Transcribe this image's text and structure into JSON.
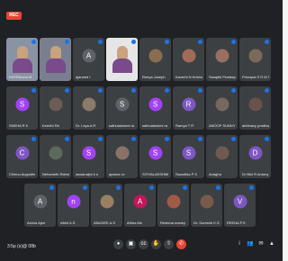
{
  "meeting": {
    "recording_badge": "REC",
    "time_label": "3:5p (s)@ 08b"
  },
  "participants": [
    {
      "name": "KEERthana M",
      "kind": "video",
      "color": "#8a93a3"
    },
    {
      "name": "",
      "kind": "video",
      "color": "#7a7f8f"
    },
    {
      "name": "ajaneed I",
      "kind": "avatar",
      "initial": "A",
      "color": "#5f6368"
    },
    {
      "name": "San....",
      "kind": "video",
      "color": "#e6e6e6"
    },
    {
      "name": "Reeya Joseph",
      "kind": "photo",
      "color": "#8a6e52"
    },
    {
      "name": "Kaverhi N Krishnab...",
      "kind": "photo",
      "color": "#a06a5a"
    },
    {
      "name": "Swapthi Pradeep",
      "kind": "photo",
      "color": "#9a6f63"
    },
    {
      "name": "Principal S R M T...",
      "kind": "photo",
      "color": "#7a6a5a"
    },
    {
      "name": "SNEHA R K",
      "kind": "avatar",
      "initial": "S",
      "color": "#a142f4"
    },
    {
      "name": "Keerthi Re",
      "kind": "photo",
      "color": "#6a5d55"
    },
    {
      "name": "Dr. Leya A R",
      "kind": "photo",
      "color": "#8a7b6a"
    },
    {
      "name": "sathulakshmi ra",
      "kind": "avatar",
      "initial": "S",
      "color": "#5f6368"
    },
    {
      "name": "sathulakshmi ra",
      "kind": "avatar",
      "initial": "S",
      "color": "#a142f4"
    },
    {
      "name": "Ramya T R",
      "kind": "avatar",
      "initial": "R",
      "color": "#7e57c2"
    },
    {
      "name": "ANOOP SUNNY",
      "kind": "photo",
      "color": "#75695c"
    },
    {
      "name": "abhinavy pradhap...",
      "kind": "photo",
      "color": "#6a5248"
    },
    {
      "name": "Chinnu Augustin",
      "kind": "avatar",
      "initial": "C",
      "color": "#7e57c2"
    },
    {
      "name": "Nehameth Rahim",
      "kind": "photo",
      "color": "#5a6a5a"
    },
    {
      "name": "aswanajini k s",
      "kind": "avatar",
      "initial": "S",
      "color": "#a142f4"
    },
    {
      "name": "aparna vv",
      "kind": "photo",
      "color": "#8a7268"
    },
    {
      "name": "SITHALAKSHMI ra...",
      "kind": "avatar",
      "initial": "S",
      "color": "#a142f4"
    },
    {
      "name": "Swanthia P S",
      "kind": "avatar",
      "initial": "S",
      "color": "#7e57c2"
    },
    {
      "name": "Anagha",
      "kind": "photo",
      "color": "#6e5a4e"
    },
    {
      "name": "Dr Bini R Antony",
      "kind": "avatar",
      "initial": "D",
      "color": "#7e57c2"
    },
    {
      "name": "Ashna Ajee",
      "kind": "avatar",
      "initial": "A",
      "color": "#5f6368"
    },
    {
      "name": "nikhil A.S",
      "kind": "avatar",
      "initial": "n",
      "color": "#a142f4"
    },
    {
      "name": "ANUDEE A.S",
      "kind": "photo",
      "color": "#9a8060"
    },
    {
      "name": "Athira Ms",
      "kind": "avatar",
      "initial": "A",
      "color": "#c2185b"
    },
    {
      "name": "Reshma maney",
      "kind": "photo",
      "color": "#a05a45"
    },
    {
      "name": "Dr. Sureshb K.S",
      "kind": "photo",
      "color": "#7a5a4a"
    },
    {
      "name": "REENA P.S",
      "kind": "avatar",
      "initial": "V",
      "color": "#7e57c2"
    }
  ],
  "controls": {
    "mic_icon": "●",
    "cam_icon": "▣",
    "cc_icon": "cc",
    "hand_icon": "✋",
    "present_icon": "⇧",
    "more_icon": "⋮",
    "leave_icon": "✆",
    "info_icon": "i",
    "people_icon": "👥",
    "chat_icon": "✉",
    "activities_icon": "▲"
  }
}
